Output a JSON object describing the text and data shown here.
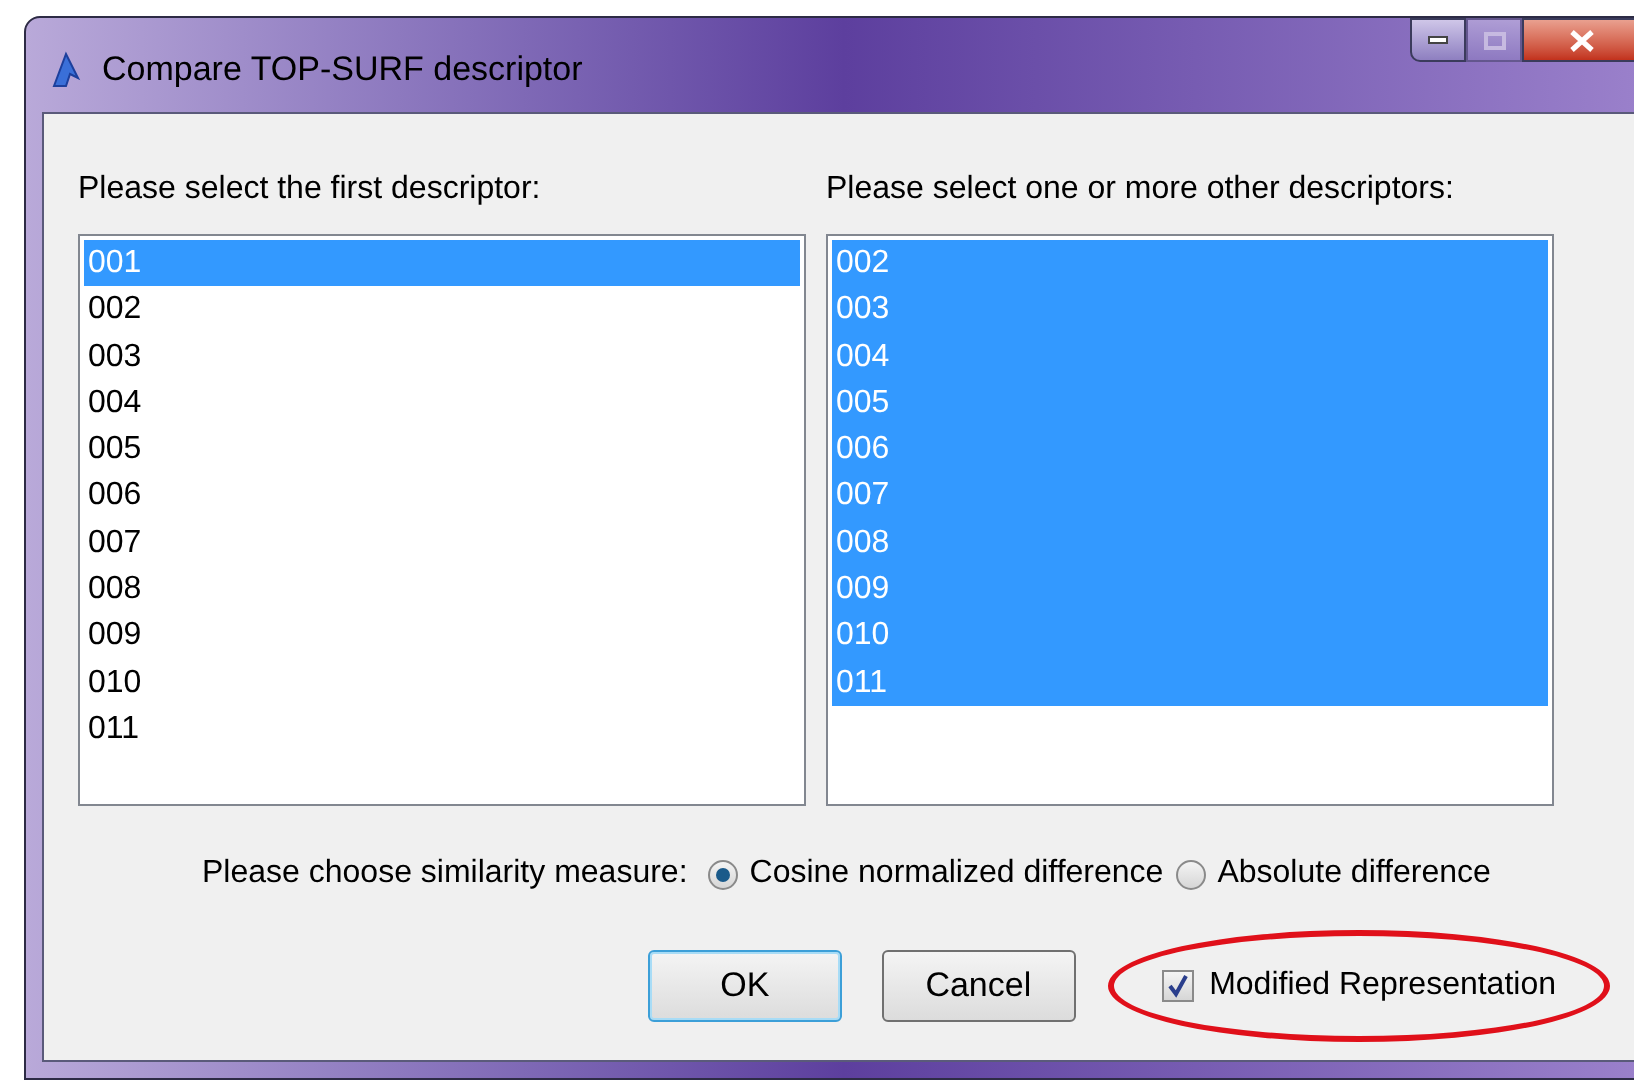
{
  "window": {
    "title": "Compare TOP-SURF descriptor",
    "controls": [
      {
        "kind": "minimize",
        "disabled": false
      },
      {
        "kind": "maximize",
        "disabled": true
      },
      {
        "kind": "close",
        "disabled": false
      }
    ]
  },
  "first_list": {
    "label": "Please select the first descriptor:",
    "items": [
      {
        "text": "001",
        "selected": true
      },
      {
        "text": "002",
        "selected": false
      },
      {
        "text": "003",
        "selected": false
      },
      {
        "text": "004",
        "selected": false
      },
      {
        "text": "005",
        "selected": false
      },
      {
        "text": "006",
        "selected": false
      },
      {
        "text": "007",
        "selected": false
      },
      {
        "text": "008",
        "selected": false
      },
      {
        "text": "009",
        "selected": false
      },
      {
        "text": "010",
        "selected": false
      },
      {
        "text": "011",
        "selected": false
      }
    ]
  },
  "other_list": {
    "label": "Please select one or more other descriptors:",
    "items": [
      {
        "text": "002",
        "selected": true
      },
      {
        "text": "003",
        "selected": true
      },
      {
        "text": "004",
        "selected": true
      },
      {
        "text": "005",
        "selected": true
      },
      {
        "text": "006",
        "selected": true
      },
      {
        "text": "007",
        "selected": true
      },
      {
        "text": "008",
        "selected": true
      },
      {
        "text": "009",
        "selected": true
      },
      {
        "text": "010",
        "selected": true
      },
      {
        "text": "011",
        "selected": true
      }
    ]
  },
  "similarity": {
    "label": "Please choose similarity measure:",
    "options": [
      {
        "label": "Cosine normalized difference",
        "selected": true
      },
      {
        "label": "Absolute difference",
        "selected": false
      }
    ]
  },
  "buttons": [
    {
      "label": "OK",
      "default": true
    },
    {
      "label": "Cancel",
      "default": false
    }
  ],
  "modified_representation": {
    "label": "Modified Representation",
    "checked": true,
    "highlighted": true
  }
}
